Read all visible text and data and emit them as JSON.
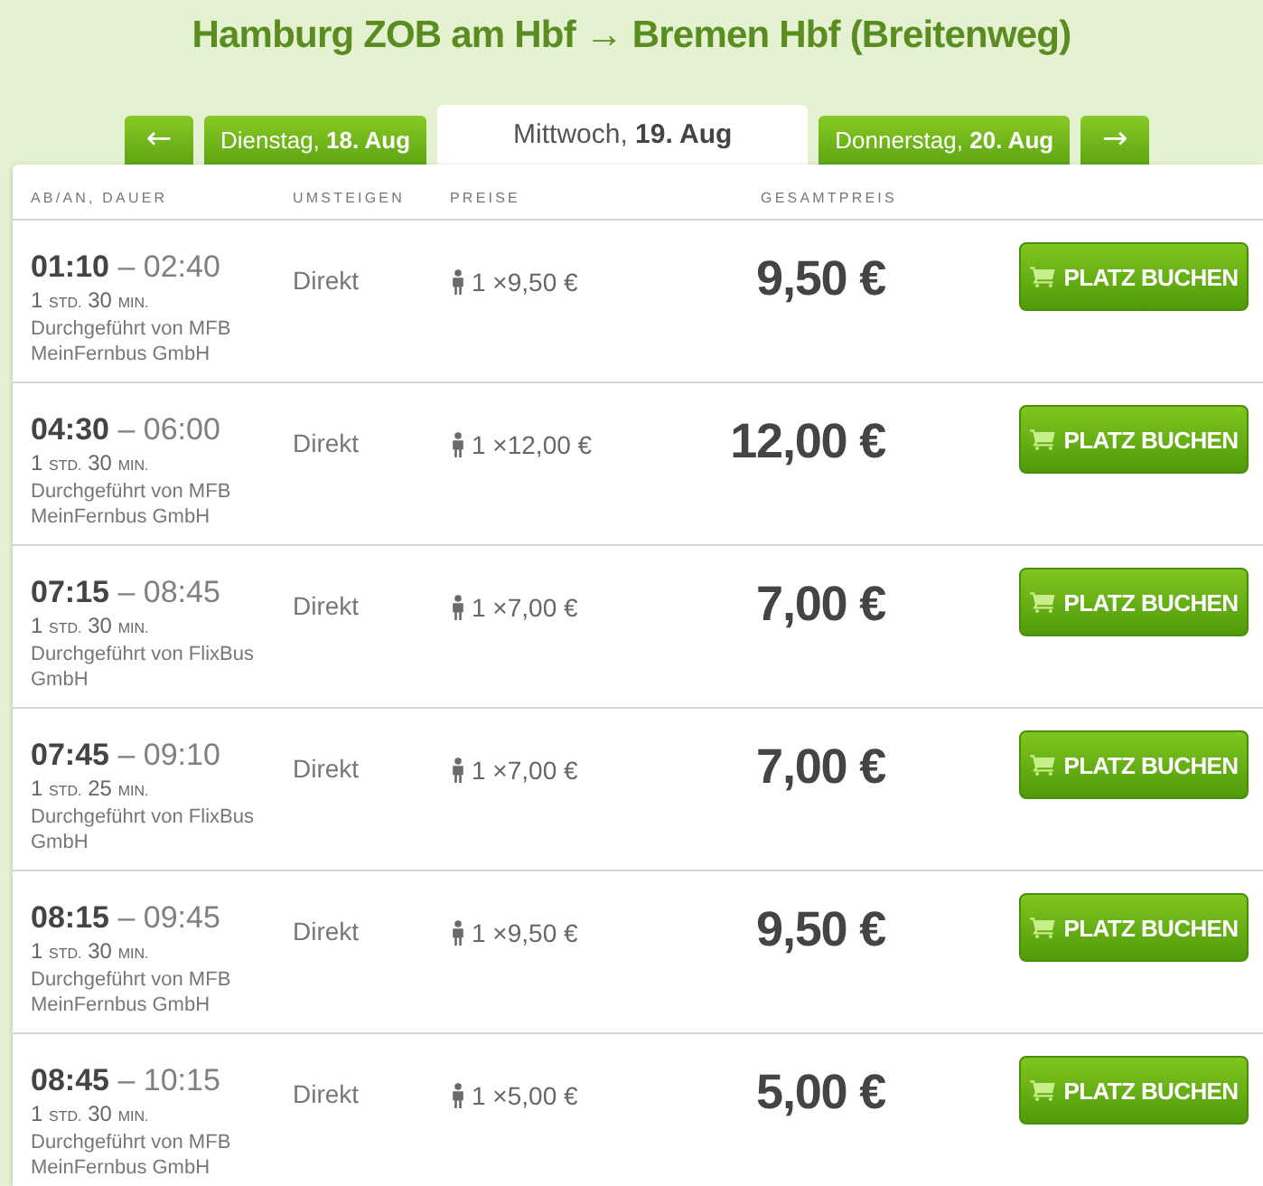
{
  "title": "Hamburg ZOB am Hbf → Bremen Hbf (Breitenweg)",
  "date_nav": {
    "prev": "←",
    "tabs": [
      {
        "label": "Dienstag, **18. Aug**",
        "selected": false
      },
      {
        "label": "Mittwoch, **19. Aug**",
        "selected": true
      },
      {
        "label": "Donnerstag, **20. Aug**",
        "selected": false
      }
    ],
    "next": "→"
  },
  "results": {
    "columns": [
      "AB/AN, DAUER",
      "UMSTEIGEN",
      "PREISE",
      "GESAMTPREIS"
    ],
    "rows": [
      {
        "time": "**01:10** – 02:40",
        "duration": {
          "hours": "1",
          "hours_unit": "STD.",
          "minutes": "30",
          "minutes_unit": "MIN."
        },
        "operator": "Durchgeführt von MFB MeinFernbus GmbH",
        "transfers": "Direkt",
        "fare": "1 ×9,50 €",
        "total": "9,50 €",
        "button": "PLATZ BUCHEN"
      },
      {
        "time": "**04:30** – 06:00",
        "duration": {
          "hours": "1",
          "hours_unit": "STD.",
          "minutes": "30",
          "minutes_unit": "MIN."
        },
        "operator": "Durchgeführt von MFB MeinFernbus GmbH",
        "transfers": "Direkt",
        "fare": "1 ×12,00 €",
        "total": "12,00 €",
        "button": "PLATZ BUCHEN"
      },
      {
        "time": "**07:15** – 08:45",
        "duration": {
          "hours": "1",
          "hours_unit": "STD.",
          "minutes": "30",
          "minutes_unit": "MIN."
        },
        "operator": "Durchgeführt von FlixBus GmbH",
        "transfers": "Direkt",
        "fare": "1 ×7,00 €",
        "total": "7,00 €",
        "button": "PLATZ BUCHEN"
      },
      {
        "time": "**07:45** – 09:10",
        "duration": {
          "hours": "1",
          "hours_unit": "STD.",
          "minutes": "25",
          "minutes_unit": "MIN."
        },
        "operator": "Durchgeführt von FlixBus GmbH",
        "transfers": "Direkt",
        "fare": "1 ×7,00 €",
        "total": "7,00 €",
        "button": "PLATZ BUCHEN"
      },
      {
        "time": "**08:15** – 09:45",
        "duration": {
          "hours": "1",
          "hours_unit": "STD.",
          "minutes": "30",
          "minutes_unit": "MIN."
        },
        "operator": "Durchgeführt von MFB MeinFernbus GmbH",
        "transfers": "Direkt",
        "fare": "1 ×9,50 €",
        "total": "9,50 €",
        "button": "PLATZ BUCHEN"
      },
      {
        "time": "**08:45** – 10:15",
        "duration": {
          "hours": "1",
          "hours_unit": "STD.",
          "minutes": "30",
          "minutes_unit": "MIN."
        },
        "operator": "Durchgeführt von MFB MeinFernbus GmbH",
        "transfers": "Direkt",
        "fare": "1 ×5,00 €",
        "total": "5,00 €",
        "button": "PLATZ BUCHEN"
      }
    ]
  }
}
